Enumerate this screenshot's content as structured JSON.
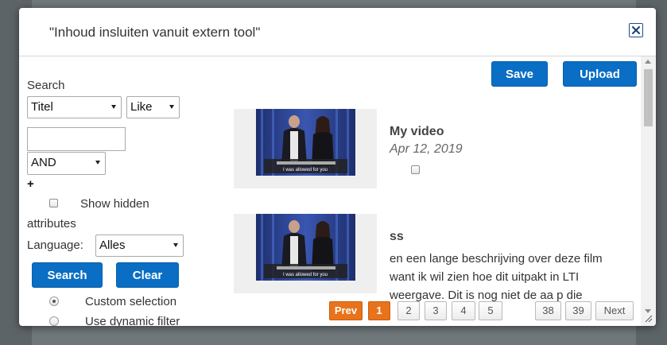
{
  "dialog": {
    "title": "\"Inhoud insluiten vanuit extern tool\"",
    "close_icon": "close-icon"
  },
  "toolbar": {
    "save_label": "Save",
    "upload_label": "Upload"
  },
  "search_panel": {
    "search_label": "Search",
    "field_select": "Titel",
    "operator_select": "Like",
    "value_input": "",
    "logic_select": "AND",
    "add_label": "+",
    "show_hidden_label": "Show hidden",
    "attributes_label": "attributes",
    "language_label": "Language:",
    "language_select": "Alles",
    "search_button": "Search",
    "clear_button": "Clear",
    "custom_selection_label": "Custom selection",
    "dynamic_filter_label": "Use dynamic filter"
  },
  "results": [
    {
      "title": "My video",
      "date": "Apr 12, 2019",
      "caption": "I was allowed for you"
    },
    {
      "title": "ss",
      "description": "en een lange beschrijving over deze film want ik wil zien hoe dit uitpakt in LTI weergave. Dit is nog niet de aa                    p     die",
      "caption": "I was allowed for you"
    }
  ],
  "pagination": {
    "prev": "Prev",
    "pages": [
      "1",
      "2",
      "3",
      "4",
      "5",
      "38",
      "39"
    ],
    "current_page": "1",
    "next": "Next"
  },
  "colors": {
    "primary_button": "#0a6ec4",
    "pager_active": "#e8731a"
  }
}
